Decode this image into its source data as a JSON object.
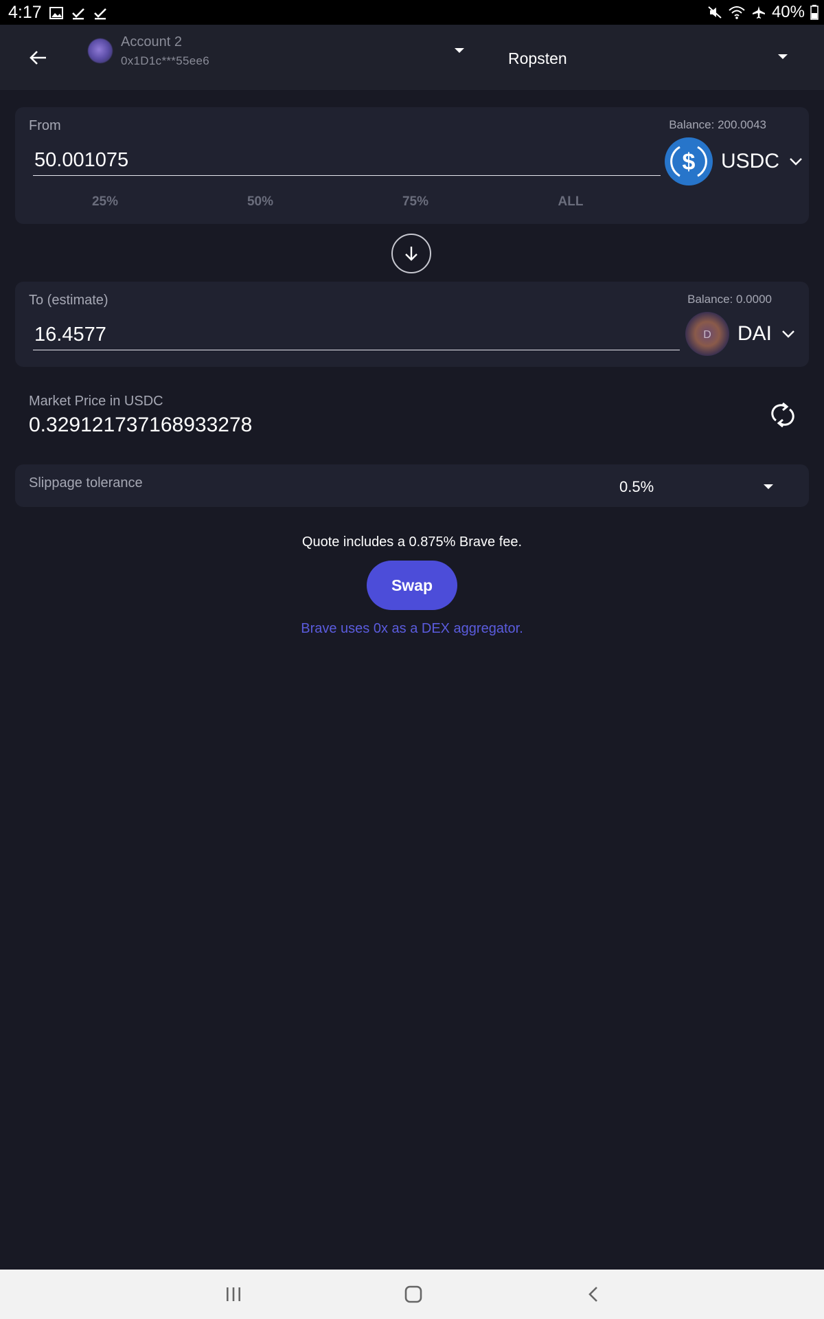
{
  "status_bar": {
    "time": "4:17",
    "battery": "40%"
  },
  "header": {
    "account_name": "Account 2",
    "account_address": "0x1D1c***55ee6",
    "network": "Ropsten"
  },
  "from": {
    "label": "From",
    "balance": "Balance: 200.0043",
    "amount": "50.001075",
    "token_symbol": "USDC",
    "token_color": "#2775ca",
    "percentages": [
      "25%",
      "50%",
      "75%",
      "ALL"
    ]
  },
  "to": {
    "label": "To (estimate)",
    "balance": "Balance: 0.0000",
    "amount": "16.4577",
    "token_symbol": "DAI",
    "token_logo_letter": "D"
  },
  "market": {
    "label": "Market Price in USDC",
    "value": "0.329121737168933278"
  },
  "slippage": {
    "label": "Slippage tolerance",
    "value": "0.5%"
  },
  "fee_text": "Quote includes a 0.875% Brave fee.",
  "swap_label": "Swap",
  "dex_link": "Brave uses 0x as a DEX aggregator.",
  "colors": {
    "background": "#181924",
    "card": "#202230",
    "accent": "#4c4dd9"
  }
}
